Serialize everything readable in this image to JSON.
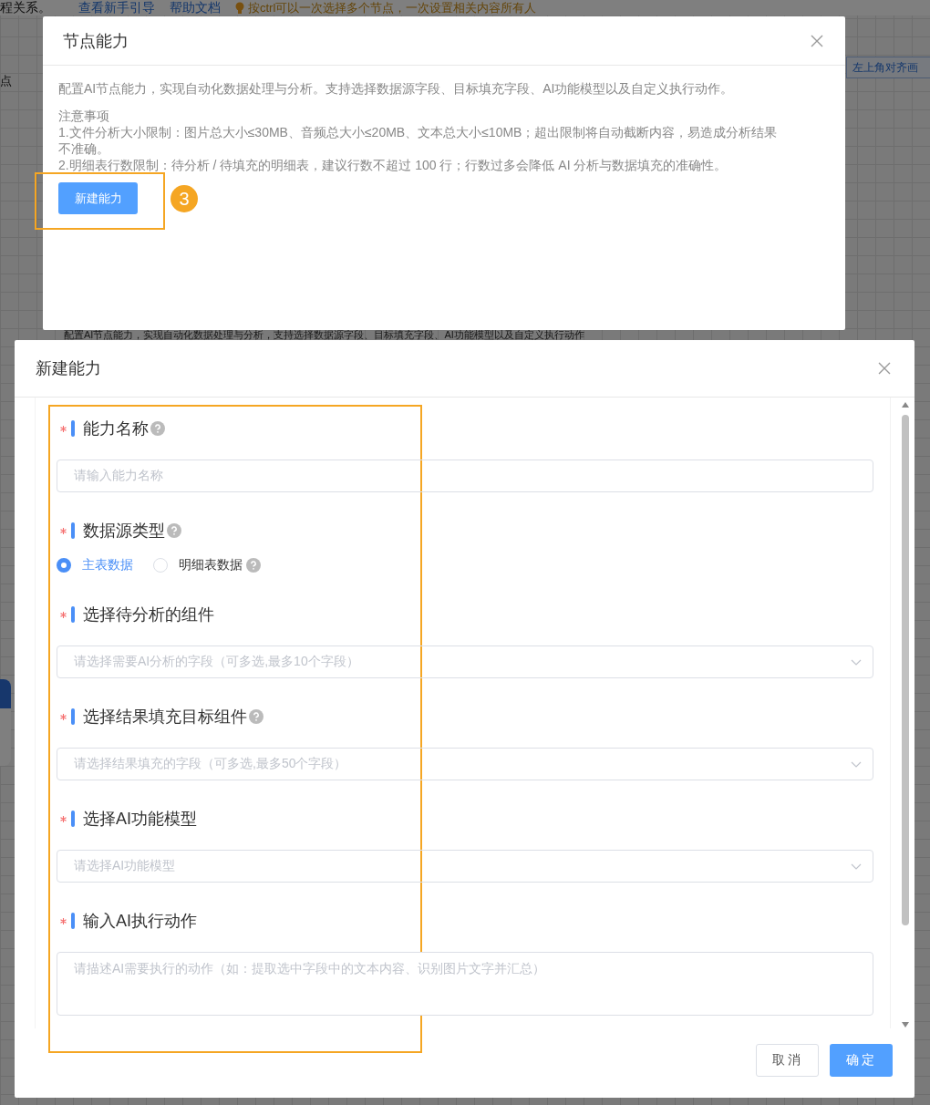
{
  "background": {
    "intro_text": "程关系。",
    "links": [
      "查看新手引导",
      "帮助文档"
    ],
    "tip": "按ctrl可以一次选择多个节点，一次设置相关内容所有人",
    "left_label": "点",
    "align_button": "左上角对齐画",
    "obscured_text": "配置AI节点能力，实现自动化数据处理与分析，支持选择数据源字段、目标填充字段、AI功能模型以及自定义执行动作"
  },
  "node_dialog": {
    "title": "节点能力",
    "description": "配置AI节点能力，实现自动化数据处理与分析。支持选择数据源字段、目标填充字段、AI功能模型以及自定义执行动作。",
    "notice_title": "注意事项",
    "notices": [
      "1.文件分析大小限制：图片总大小≤30MB、音频总大小≤20MB、文本总大小≤10MB；超出限制将自动截断内容，易造成分析结果不准确。",
      "2.明细表行数限制：待分析 / 待填充的明细表，建议行数不超过 100 行；行数过多会降低 AI 分析与数据填充的准确性。"
    ],
    "new_button": "新建能力",
    "step_badge": "3"
  },
  "create_dialog": {
    "title": "新建能力",
    "fields": [
      {
        "kind": "input",
        "label": "能力名称",
        "required": true,
        "help": true,
        "placeholder": "请输入能力名称"
      },
      {
        "kind": "radio",
        "label": "数据源类型",
        "required": true,
        "help": true,
        "options": [
          {
            "label": "主表数据",
            "selected": true,
            "help": false
          },
          {
            "label": "明细表数据",
            "selected": false,
            "help": true
          }
        ]
      },
      {
        "kind": "select",
        "label": "选择待分析的组件",
        "required": true,
        "help": false,
        "placeholder": "请选择需要AI分析的字段（可多选,最多10个字段）"
      },
      {
        "kind": "select",
        "label": "选择结果填充目标组件",
        "required": true,
        "help": true,
        "placeholder": "请选择结果填充的字段（可多选,最多50个字段）"
      },
      {
        "kind": "select",
        "label": "选择AI功能模型",
        "required": true,
        "help": false,
        "placeholder": "请选择AI功能模型"
      },
      {
        "kind": "textarea",
        "label": "输入AI执行动作",
        "required": true,
        "help": false,
        "placeholder": "请描述AI需要执行的动作（如：提取选中字段中的文本内容、识别图片文字并汇总）"
      }
    ],
    "buttons": [
      {
        "label": "取消",
        "kind": "default"
      },
      {
        "label": "确定",
        "kind": "primary"
      }
    ]
  }
}
